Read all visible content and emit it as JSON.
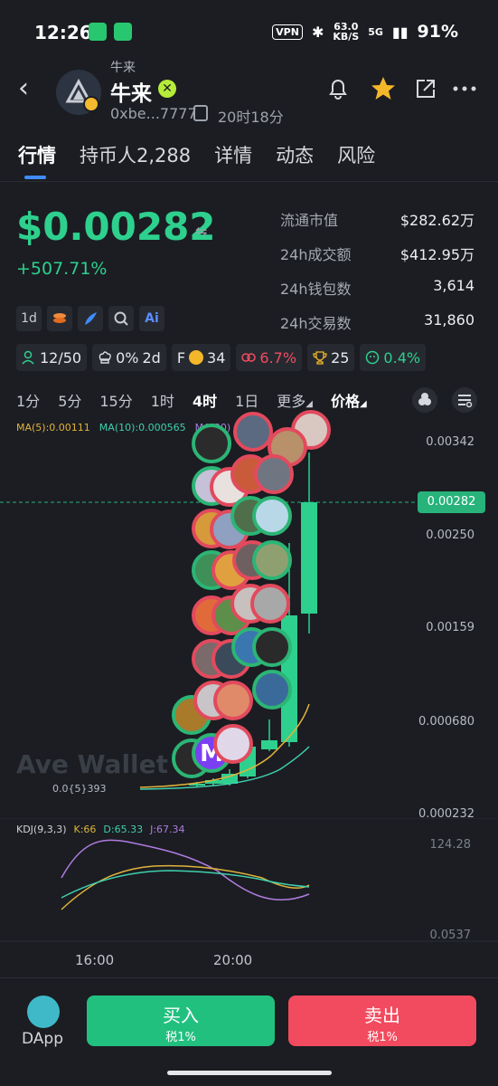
{
  "status_bar": {
    "time": "12:26",
    "vpn": "VPN",
    "net_speed": "63.0",
    "net_unit": "KB/S",
    "signal": "5G",
    "battery": "91%"
  },
  "header": {
    "token_small": "牛来",
    "token_name": "牛来",
    "address": "0xbe...7777",
    "age": "20时18分"
  },
  "tabs": [
    {
      "label": "行情",
      "active": true
    },
    {
      "label": "持币人2,288"
    },
    {
      "label": "详情"
    },
    {
      "label": "动态"
    },
    {
      "label": "风险"
    }
  ],
  "price": {
    "value": "$0.00282",
    "change": "+507.71%"
  },
  "stats": [
    {
      "k": "流通市值",
      "v": "$282.62万"
    },
    {
      "k": "24h成交额",
      "v": "$412.95万"
    },
    {
      "k": "24h钱包数",
      "v": "3,614"
    },
    {
      "k": "24h交易数",
      "v": "31,860"
    }
  ],
  "mini_row": {
    "period": "1d",
    "ai": "Ai"
  },
  "chips": [
    {
      "text": "12/50",
      "color": "#2ed08e"
    },
    {
      "text": "0%",
      "text2": "2d",
      "color": "#d6d8dd"
    },
    {
      "prefix": "F",
      "text": "34",
      "color": "#e6e8ec"
    },
    {
      "text": "6.7%",
      "color": "#f24a5e"
    },
    {
      "text": "25",
      "color": "#e6e8ec"
    },
    {
      "text": "0.4%",
      "color": "#2ed08e"
    }
  ],
  "timeframes": [
    "1分",
    "5分",
    "15分",
    "1时",
    "4时",
    "1日",
    "更多",
    "价格"
  ],
  "timeframe_active": "4时",
  "ma_legend": {
    "ma5": "MA(5):0.00111",
    "ma10": "MA(10):0.000565",
    "ma30": "MA(30)"
  },
  "y_labels": [
    "0.00342",
    "0.00282",
    "0.00250",
    "0.00159",
    "0.000680",
    "0.000232"
  ],
  "current_price_tag": "0.00282",
  "low_label": "0.0{5}393",
  "watermark": "Ave Wallet",
  "kdj": {
    "title": "KDJ(9,3,3)",
    "k": "K:66",
    "d": "D:65.33",
    "j": "J:67.34",
    "top": "124.28",
    "bottom": "0.0537"
  },
  "x_labels": [
    "16:00",
    "20:00"
  ],
  "bottom": {
    "dapp": "DApp",
    "buy": "买入",
    "buy_tax": "税1%",
    "sell": "卖出",
    "sell_tax": "税1%"
  },
  "colors": {
    "up": "#2ed08e",
    "down": "#f24a5e",
    "accent": "#3f8cff"
  }
}
